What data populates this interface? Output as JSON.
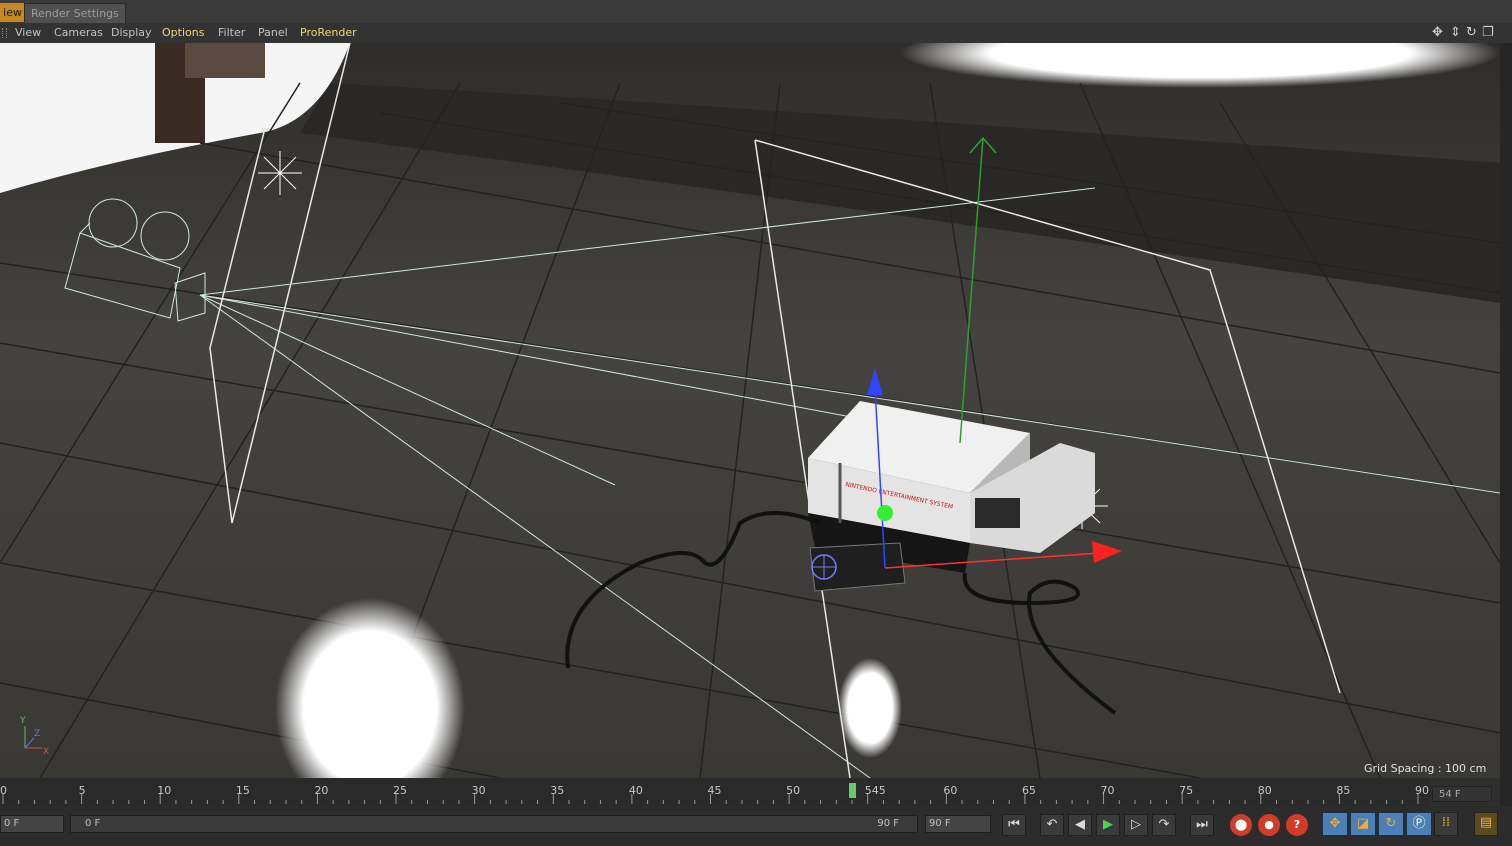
{
  "tabs": {
    "view": "iew",
    "render_settings": "Render Settings"
  },
  "menu": {
    "view": "View",
    "cameras": "Cameras",
    "display": "Display",
    "options": "Options",
    "filter": "Filter",
    "panel": "Panel",
    "prorender": "ProRender"
  },
  "nav_icons": [
    "move-view-icon",
    "dolly-view-icon",
    "rotate-view-icon",
    "toggle-layout-icon"
  ],
  "viewport": {
    "grid_spacing": "Grid Spacing : 100 cm",
    "axis_labels": {
      "y": "Y",
      "z": "Z",
      "x": "X"
    },
    "label_text": "NINTENDO ENTERTAINMENT SYSTEM"
  },
  "timeline": {
    "ticks": [
      "0",
      "5",
      "10",
      "15",
      "20",
      "25",
      "30",
      "35",
      "40",
      "45",
      "50",
      "545",
      "60",
      "65",
      "70",
      "75",
      "80",
      "85",
      "90"
    ],
    "current_frame": 54,
    "end_badge": "54 F"
  },
  "transport": {
    "start_field": "0 F",
    "range_start": "0 F",
    "range_end": "90 F",
    "end_field": "90 F"
  },
  "colors": {
    "accent_orange": "#c58a1f",
    "menu_highlight": "#f0d67a",
    "playhead": "#66cc66",
    "record_red": "#d23a2a",
    "tool_blue": "#4c7fb5"
  }
}
